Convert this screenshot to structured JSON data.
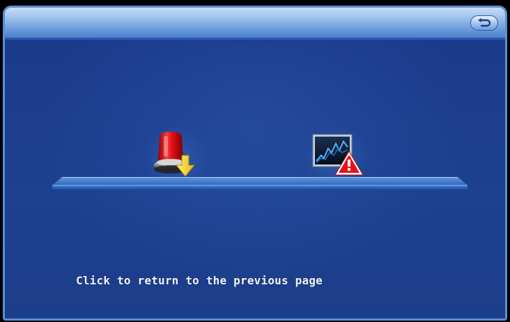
{
  "header": {
    "back_icon": "return-arrow-icon"
  },
  "main": {
    "icons": [
      {
        "name": "alarm-download-icon",
        "label": ""
      },
      {
        "name": "chart-warning-icon",
        "label": ""
      }
    ],
    "hint": "Click to return to the previous page"
  },
  "colors": {
    "background": "#1b3a8a",
    "title_bar": "#9cc0ea",
    "border": "#5b8fd6",
    "text": "#f2f4fa",
    "alarm_red": "#e0101a",
    "arrow_yellow": "#f3d21a",
    "warning_red": "#e3141c"
  }
}
